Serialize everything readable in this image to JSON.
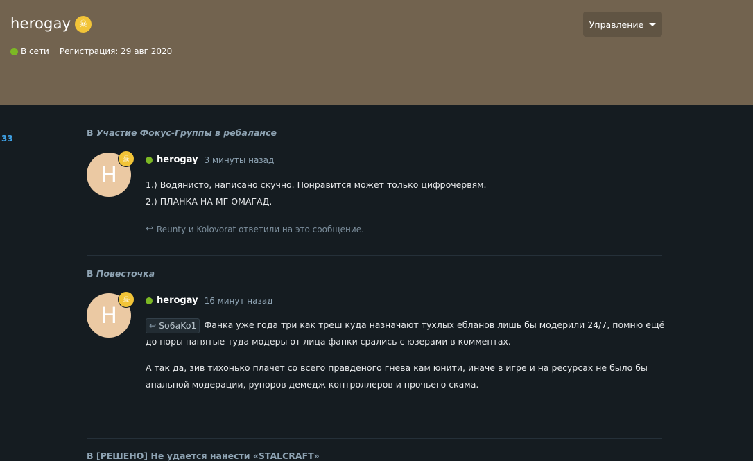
{
  "profile": {
    "username": "herogay",
    "status": "В сети",
    "registration": "Регистрация: 29 авг 2020",
    "manage_label": "Управление",
    "badge_icon": "☠"
  },
  "sidebar": {
    "count": "33"
  },
  "posts": [
    {
      "thread_prefix": "В ",
      "thread_name": "Участие Фокус-Группы в ребалансе",
      "avatar_letter": "H",
      "user": "herogay",
      "time": "3 минуты назад",
      "lines": [
        "1.) Водянисто, написано скучно. Понравится может только цифрочервям.",
        "2.) ПЛАНКА НА МГ ОМАГАД."
      ],
      "replies_text": "Reunty и Kolovorat ответили на это сообщение."
    },
    {
      "thread_prefix": "В ",
      "thread_name": "Повесточка",
      "avatar_letter": "H",
      "user": "herogay",
      "time": "16 минут назад",
      "quote_user": "So6aKo1",
      "para1": "Фанка уже года три как треш куда назначают тухлых ебланов лишь бы модерили 24/7, помню ещё до поры нанятые туда модеры от лица фанки срались с юзерами в комментах.",
      "para2": "А так да, зив тихонько плачет со всего правденого гнева кам юнити, иначе в игре и на ресурсах не было бы анальной модерации, рупоров демедж контроллеров и прочьего скама."
    },
    {
      "thread_text": "В [РЕШЕНО] Не удается нанести «STALCRAFT»"
    }
  ],
  "colors": {
    "header_bg": "#72634f",
    "page_bg": "#151c21",
    "online": "#7cb824",
    "badge": "#f2c438",
    "link": "#8fa4b4",
    "count": "#3fa1e5"
  }
}
